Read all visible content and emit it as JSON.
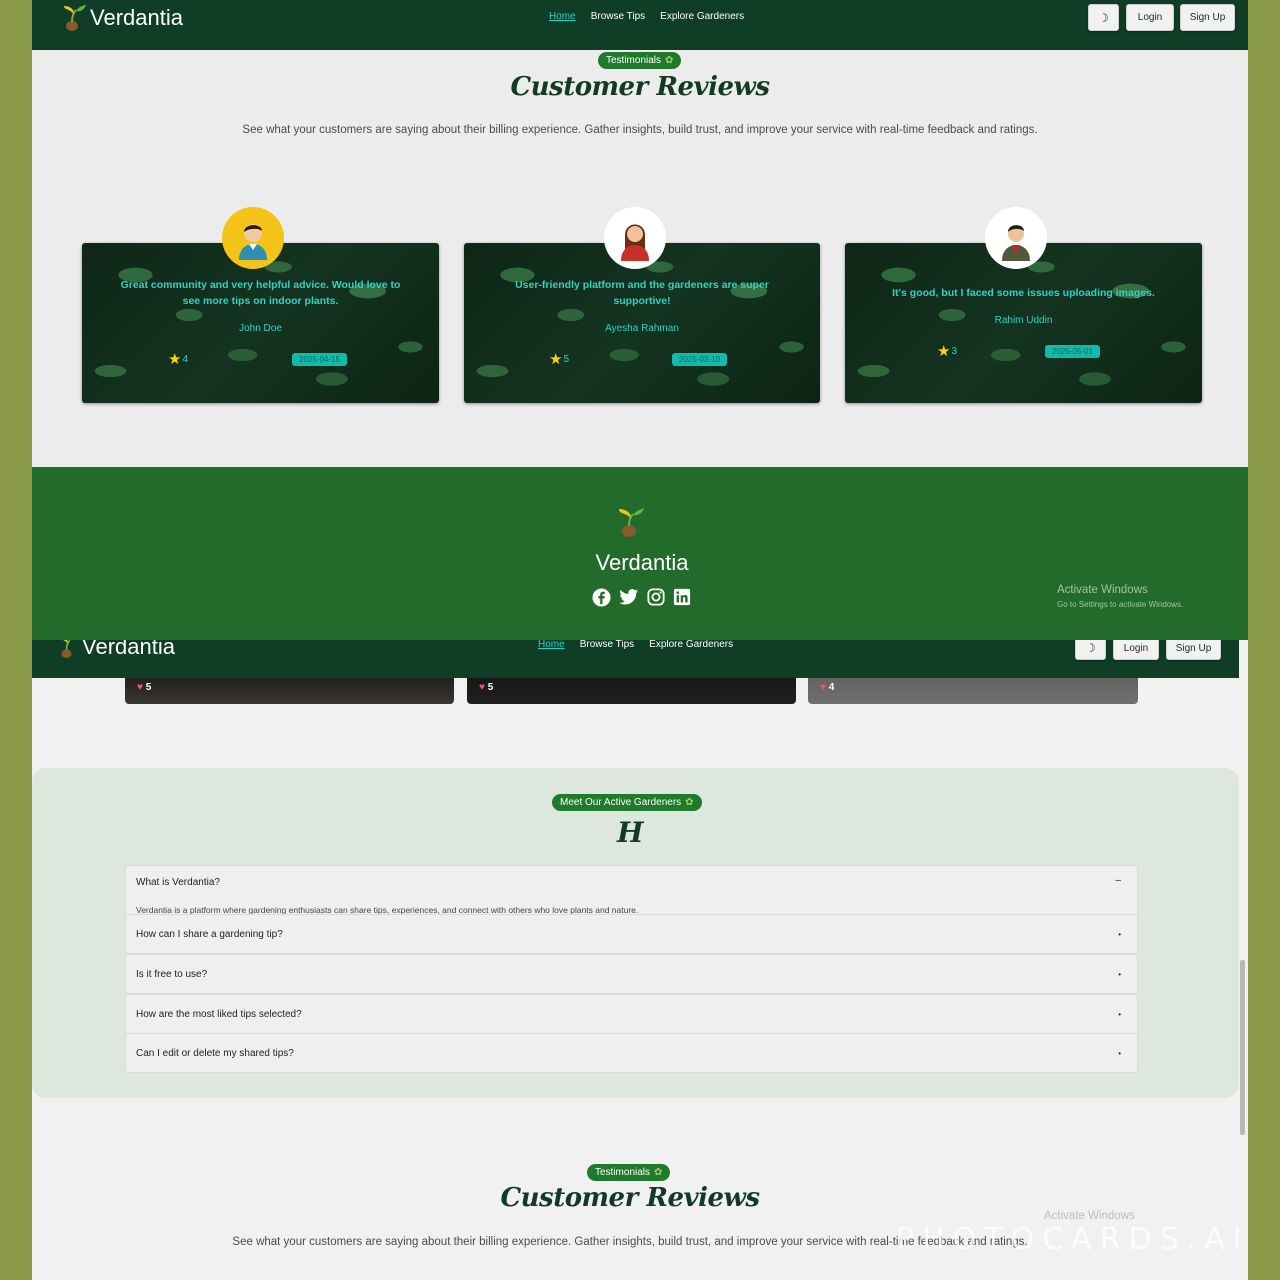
{
  "top": {
    "brand": "Verdantia",
    "nav": {
      "home": "Home",
      "browse": "Browse Tips",
      "explore": "Explore Gardeners"
    },
    "buttons": {
      "theme_icon": "moon-icon",
      "login": "Login",
      "signup": "Sign Up"
    },
    "badge": "Testimonials",
    "title": "Customer Reviews",
    "subtitle": "See what your customers are saying about their billing experience. Gather insights, build trust, and improve your service with real-time feedback and ratings.",
    "reviews": [
      {
        "text": "Great community and very helpful advice. Would love to see more tips on indoor plants.",
        "name": "John Doe",
        "rating": "4",
        "date": "2025-04-15"
      },
      {
        "text": "User-friendly platform and the gardeners are super supportive!",
        "name": "Ayesha Rahman",
        "rating": "5",
        "date": "2025-03-10"
      },
      {
        "text": "It's good, but I faced some issues uploading images.",
        "name": "Rahim Uddin",
        "rating": "3",
        "date": "2025-05-01"
      }
    ],
    "footer": {
      "brand": "Verdantia",
      "social": [
        "facebook-icon",
        "twitter-icon",
        "instagram-icon",
        "linkedin-icon"
      ]
    },
    "watermark": {
      "line1": "Activate Windows",
      "line2": "Go to Settings to activate Windows."
    }
  },
  "bottom": {
    "brand": "Verdantia",
    "nav": {
      "home": "Home",
      "browse": "Browse Tips",
      "explore": "Explore Gardeners"
    },
    "buttons": {
      "login": "Login",
      "signup": "Sign Up"
    },
    "likes": [
      "5",
      "5",
      "4"
    ],
    "badge": "Meet Our Active Gardeners",
    "heading": "H",
    "faq": [
      {
        "q": "What is Verdantia?",
        "a": "Verdantia is a platform where gardening enthusiasts can share tips, experiences, and connect with others who love plants and nature.",
        "open": true
      },
      {
        "q": "How can I share a gardening tip?",
        "open": false
      },
      {
        "q": "Is it free to use?",
        "open": false
      },
      {
        "q": "How are the most liked tips selected?",
        "open": false
      },
      {
        "q": "Can I edit or delete my shared tips?",
        "open": false
      }
    ],
    "badge2": "Testimonials",
    "title2": "Customer Reviews",
    "subtitle2": "See what your customers are saying about their billing experience. Gather insights, build trust, and improve your service with real-time feedback and ratings.",
    "watermark": {
      "line1": "Activate Windows"
    }
  },
  "overlay_brand": "PHOTOCARDS.AI",
  "colors": {
    "nav": "#0f3d26",
    "footer": "#226b2b",
    "accent": "#22d3c5",
    "pill": "#1f7a2c",
    "frame": "#8c9a4c"
  }
}
